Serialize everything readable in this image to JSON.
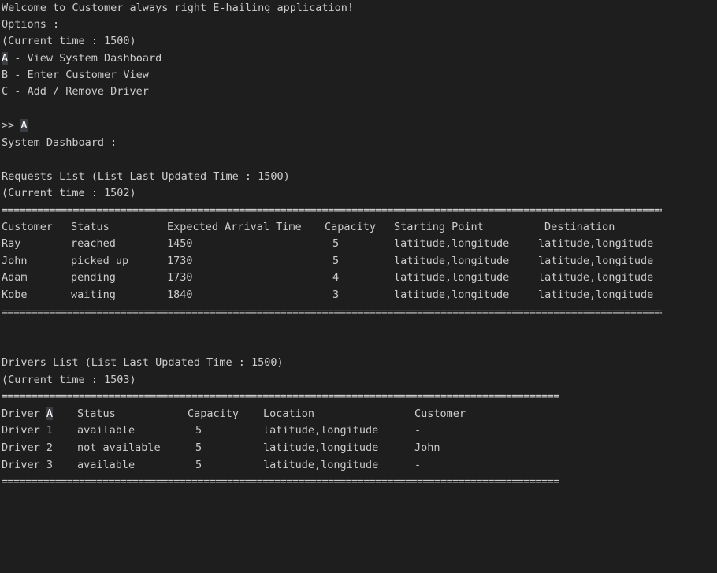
{
  "welcome": "Welcome to Customer always right E-hailing application!",
  "options_label": "Options :",
  "current_time_1": "(Current time : 1500)",
  "menu": {
    "a_key": "A",
    "a_rest": " - View System Dashboard",
    "b": "B - Enter Customer View",
    "c": "C - Add / Remove Driver"
  },
  "prompt": {
    "symbol": ">> ",
    "input": "A"
  },
  "dashboard_title": "System Dashboard :",
  "requests": {
    "title": "Requests List (List Last Updated Time : 1500)",
    "current_time": "(Current time : 1502)",
    "rule": "=======================================================================================================================",
    "headers": [
      "Customer",
      "Status",
      "Expected Arrival Time",
      "Capacity",
      "Starting Point",
      "Destination"
    ],
    "rows": [
      [
        "Ray",
        "reached",
        "1450",
        "5",
        "latitude,longitude",
        "latitude,longitude"
      ],
      [
        "John",
        "picked up",
        "1730",
        "5",
        "latitude,longitude",
        "latitude,longitude"
      ],
      [
        "Adam",
        "pending",
        "1730",
        "4",
        "latitude,longitude",
        "latitude,longitude"
      ],
      [
        "Kobe",
        "waiting",
        "1840",
        "3",
        "latitude,longitude",
        "latitude,longitude"
      ]
    ]
  },
  "drivers": {
    "title": "Drivers List (List Last Updated Time : 1500)",
    "current_time": "(Current time : 1503)",
    "rule": "=======================================================================================================",
    "headers": [
      "Driver A",
      "Status",
      "Capacity",
      "Location",
      "Customer"
    ],
    "header_driver_prefix": "Driver ",
    "header_driver_sel": "A",
    "rows": [
      [
        "Driver 1",
        "available",
        "5",
        "latitude,longitude",
        "-"
      ],
      [
        "Driver 2",
        "not available",
        "5",
        "latitude,longitude",
        "John"
      ],
      [
        "Driver 3",
        "available",
        "5",
        "latitude,longitude",
        "-"
      ]
    ]
  }
}
